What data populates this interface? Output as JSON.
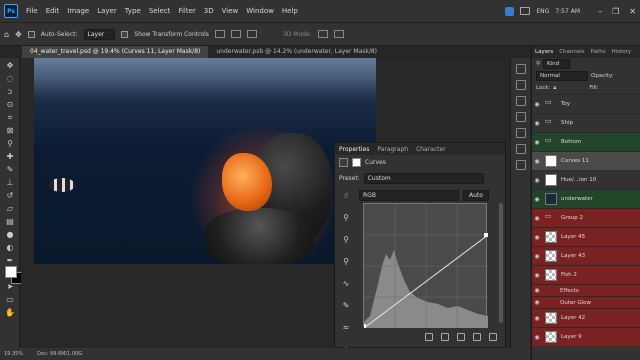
{
  "menubar": {
    "logo": "Ps",
    "items": [
      "File",
      "Edit",
      "Image",
      "Layer",
      "Type",
      "Select",
      "Filter",
      "3D",
      "View",
      "Window",
      "Help"
    ],
    "tray": {
      "lang": "ENG",
      "time": "7:57 AM"
    }
  },
  "options": {
    "auto_select_label": "Auto-Select:",
    "auto_select_value": "Layer",
    "transform_label": "Show Transform Controls",
    "mode_3d": "3D Mode:"
  },
  "tabs": [
    {
      "label": "04_water_travel.psd @ 19.4% (Curves 11, Layer Mask/8)",
      "active": true
    },
    {
      "label": "underwater.psb @ 14.2% (underwater, Layer Mask/8)",
      "active": false
    }
  ],
  "status": {
    "zoom": "19.35%",
    "doc": "Doc: 99.6M/1.00G"
  },
  "properties": {
    "tabs": [
      "Properties",
      "Paragraph",
      "Character"
    ],
    "title": "Curves",
    "preset_label": "Preset:",
    "preset_value": "Custom",
    "channel": "RGB",
    "auto_label": "Auto"
  },
  "layers_panel": {
    "tabs": [
      "Layers",
      "Channels",
      "Paths",
      "History"
    ],
    "kind_label": "Kind",
    "blend_mode": "Normal",
    "opacity_label": "Opacity:",
    "lock_label": "Lock:",
    "fill_label": "Fill:",
    "layers": [
      {
        "name": "Toy",
        "style": "plain",
        "thumb": "folder"
      },
      {
        "name": "Ship",
        "style": "plain",
        "thumb": "folder"
      },
      {
        "name": "Bottom",
        "style": "green",
        "thumb": "folder"
      },
      {
        "name": "Curves 11",
        "style": "sel",
        "thumb": "white"
      },
      {
        "name": "Hue/...ion 10",
        "style": "plain",
        "thumb": "white"
      },
      {
        "name": "underwater",
        "style": "green",
        "thumb": "dark"
      },
      {
        "name": "Group 2",
        "style": "red",
        "thumb": "folder"
      },
      {
        "name": "Layer 45",
        "style": "red",
        "thumb": "check"
      },
      {
        "name": "Layer 43",
        "style": "red",
        "thumb": "check"
      },
      {
        "name": "Fish 2",
        "style": "red",
        "thumb": "check"
      },
      {
        "name": "Effects",
        "style": "red",
        "thumb": "none"
      },
      {
        "name": "Outer Glow",
        "style": "red",
        "thumb": "none"
      },
      {
        "name": "Layer 42",
        "style": "red",
        "thumb": "check"
      },
      {
        "name": "Layer 9",
        "style": "red",
        "thumb": "check"
      }
    ]
  },
  "colors": {
    "accent": "#31a8ff",
    "red_label": "#7a2222",
    "green_label": "#22452a"
  }
}
